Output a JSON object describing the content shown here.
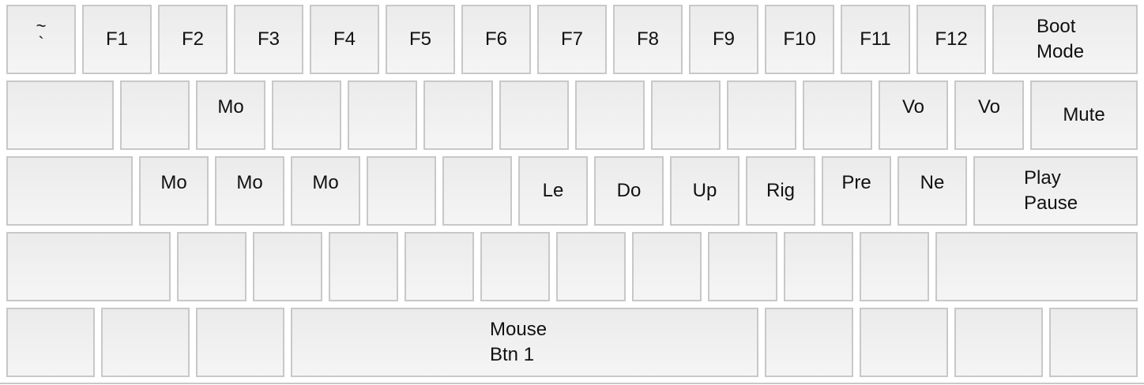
{
  "keyboard": {
    "row1": {
      "tilde": "~\n`",
      "f1": "F1",
      "f2": "F2",
      "f3": "F3",
      "f4": "F4",
      "f5": "F5",
      "f6": "F6",
      "f7": "F7",
      "f8": "F8",
      "f9": "F9",
      "f10": "F10",
      "f11": "F11",
      "f12": "F12",
      "boot": "Boot\nMode"
    },
    "row2": {
      "mo": "Mo",
      "vo1": "Vo",
      "vo2": "Vo",
      "mute": "Mute"
    },
    "row3": {
      "mo1": "Mo",
      "mo2": "Mo",
      "mo3": "Mo",
      "left": "Le",
      "down": "Do",
      "up": "Up",
      "right": "Rig",
      "prev": "Pre",
      "next": "Ne",
      "play": "Play\nPause"
    },
    "row5": {
      "space": "Mouse\nBtn 1"
    }
  }
}
